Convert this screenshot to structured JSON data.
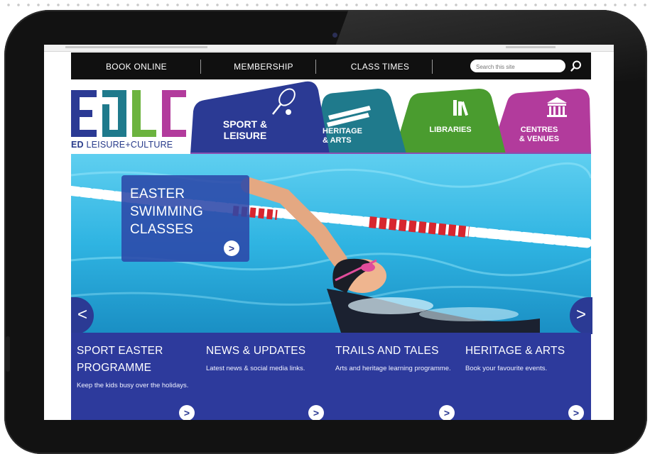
{
  "nav": {
    "book_online": "BOOK ONLINE",
    "membership": "MEMBERSHIP",
    "class_times": "CLASS TIMES",
    "search_placeholder": "Search this site"
  },
  "logo": {
    "brand_bold": "ED",
    "brand_rest": "LEISURE+CULTURE"
  },
  "tabs": [
    {
      "line1": "SPORT &",
      "line2": "LEISURE",
      "color": "#2b3a94",
      "icon": "tennis-racket-icon"
    },
    {
      "line1": "HERITAGE",
      "line2": "& ARTS",
      "color": "#1f7a8c",
      "icon": "scroll-icon"
    },
    {
      "line1": "LIBRARIES",
      "line2": "",
      "color": "#4a9c2f",
      "icon": "books-icon"
    },
    {
      "line1": "CENTRES",
      "line2": "& VENUES",
      "color": "#b23b9c",
      "icon": "building-icon"
    }
  ],
  "hero": {
    "title": "EASTER\nSWIMMING\nCLASSES",
    "button": ">",
    "prev": "<",
    "next": ">"
  },
  "features": [
    {
      "title": "SPORT EASTER PROGRAMME",
      "desc": "Keep the kids busy over the holidays.",
      "button": ">"
    },
    {
      "title": "NEWS & UPDATES",
      "desc": "Latest news & social media links.",
      "button": ">"
    },
    {
      "title": "TRAILS AND TALES",
      "desc": "Arts and heritage learning programme.",
      "button": ">"
    },
    {
      "title": "HERITAGE & ARTS",
      "desc": "Book your favourite events.",
      "button": ">"
    }
  ],
  "colors": {
    "navy": "#2b3a94",
    "teal": "#1f7a8c",
    "green": "#4a9c2f",
    "magenta": "#b23b9c",
    "pool": "#2fb4e2"
  }
}
